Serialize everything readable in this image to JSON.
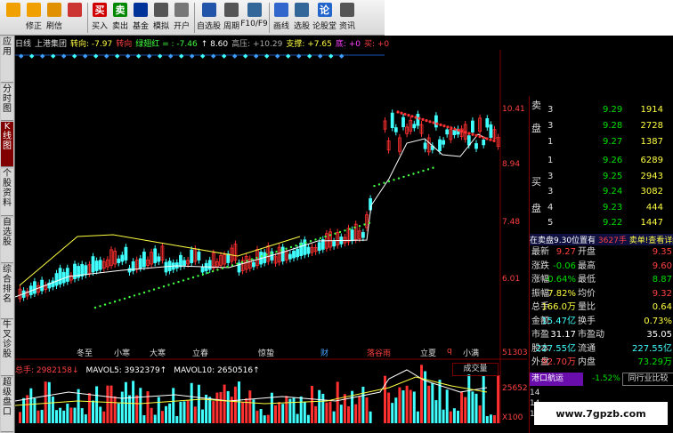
{
  "toolbar": [
    {
      "label": "",
      "icon": "back-arrow-icon",
      "color": "#f0a000"
    },
    {
      "label": "修正",
      "icon": "up-down-arrow-icon",
      "color": "#f0a000"
    },
    {
      "label": "刷信",
      "icon": "refresh-icon",
      "color": "#e09000"
    },
    {
      "label": "",
      "icon": "clock-icon",
      "color": "#cc3333"
    },
    {
      "label": "买入",
      "icon": "buy-icon",
      "color": "#d00000",
      "glyph": "买"
    },
    {
      "label": "卖出",
      "icon": "sell-icon",
      "color": "#008800",
      "glyph": "卖"
    },
    {
      "label": "基金",
      "icon": "fund-icon",
      "color": "#003399"
    },
    {
      "label": "模拟",
      "icon": "hammer-icon",
      "color": "#555555"
    },
    {
      "label": "开户",
      "icon": "lock-icon",
      "color": "#777777"
    },
    {
      "label": "自选股",
      "icon": "favorite-icon",
      "color": "#2255aa"
    },
    {
      "label": "周期",
      "icon": "cycle-icon",
      "color": "#555555"
    },
    {
      "label": "F10/F9",
      "icon": "f10-icon",
      "color": "#336699"
    },
    {
      "label": "画线",
      "icon": "pen-icon",
      "color": "#3366cc"
    },
    {
      "label": "选股",
      "icon": "filter-icon",
      "color": "#336699"
    },
    {
      "label": "论股堂",
      "icon": "forum-icon",
      "color": "#2266cc",
      "glyph": "论"
    },
    {
      "label": "资讯",
      "icon": "news-icon",
      "color": "#555555"
    }
  ],
  "sidetabs": [
    "应用",
    "分时图",
    "K线图",
    "个股资料",
    "自选股",
    "综合排名",
    "牛叉诊股",
    "超级盘口"
  ],
  "infobar": [
    {
      "text": "日线",
      "color": "#dddddd"
    },
    {
      "text": "上港集团",
      "color": "#dddddd"
    },
    {
      "text": "转向: -7.97",
      "color": "#ffff40"
    },
    {
      "text": "转向",
      "color": "#ff4040"
    },
    {
      "text": "绿翅红 = : -7.46",
      "color": "#40ff40"
    },
    {
      "text": "↑ 8.60",
      "color": "#ffffff"
    },
    {
      "text": "高压: +10.29",
      "color": "#aaaaaa"
    },
    {
      "text": "支撑: +7.65",
      "color": "#ffff40"
    },
    {
      "text": "底: +0",
      "color": "#ff40ff"
    },
    {
      "text": "买: +0",
      "color": "#ff4040"
    }
  ],
  "price_axis": [
    "10.41",
    "8.94",
    "7.48",
    "6.01"
  ],
  "volume_axis": [
    "51303",
    "25652",
    "X100"
  ],
  "date_axis": [
    {
      "t": "冬至",
      "c": "#dddddd"
    },
    {
      "t": "小寒",
      "c": "#dddddd"
    },
    {
      "t": "大寒",
      "c": "#dddddd"
    },
    {
      "t": "立春",
      "c": "#dddddd"
    },
    {
      "t": "惊蛰",
      "c": "#dddddd"
    },
    {
      "t": "财",
      "c": "#40a0ff"
    },
    {
      "t": "落谷雨",
      "c": "#ff4040"
    },
    {
      "t": "立夏",
      "c": "#dddddd"
    },
    {
      "t": "q",
      "c": "#ff4040"
    },
    {
      "t": "小满",
      "c": "#dddddd"
    }
  ],
  "volume_legend": [
    {
      "text": "总手: 2982158↓",
      "color": "#ff4040"
    },
    {
      "text": "MAVOL5: 3932379↑",
      "color": "#ffffff"
    },
    {
      "text": "MAVOL10: 2650516↑",
      "color": "#ffffff"
    }
  ],
  "volume_tab": "成交量",
  "sell_orders": [
    {
      "level": "3",
      "price": "9.29",
      "vol": "1914"
    },
    {
      "level": "3",
      "price": "9.28",
      "vol": "2728"
    },
    {
      "level": "1",
      "price": "9.27",
      "vol": "1387"
    }
  ],
  "buy_orders": [
    {
      "level": "1",
      "price": "9.26",
      "vol": "6289"
    },
    {
      "level": "3",
      "price": "9.25",
      "vol": "2943"
    },
    {
      "level": "3",
      "price": "9.24",
      "vol": "3082"
    },
    {
      "level": "4",
      "price": "9.23",
      "vol": "444"
    },
    {
      "level": "5",
      "price": "9.22",
      "vol": "1447"
    }
  ],
  "side_labels": {
    "sell1": "卖",
    "sell2": "盘",
    "buy1": "买",
    "buy2": "盘"
  },
  "order_banner": {
    "left": "在卖盘9.30位置有",
    "mid": "3627手",
    "right": "卖单!查看详细"
  },
  "stats": [
    {
      "l1": "最新",
      "v1": "9.27",
      "c1": "#ff4040",
      "l2": "开盘",
      "v2": "9.35",
      "c2": "#ff4040"
    },
    {
      "l1": "涨跌",
      "v1": "-0.06",
      "c1": "#00e000",
      "l2": "最高",
      "v2": "9.60",
      "c2": "#ff4040"
    },
    {
      "l1": "涨幅",
      "v1": "-0.64%",
      "c1": "#00e000",
      "l2": "最低",
      "v2": "8.87",
      "c2": "#00e000"
    },
    {
      "l1": "振幅",
      "v1": "7.82%",
      "c1": "#ffff40",
      "l2": "均价",
      "v2": "9.32",
      "c2": "#ff4040"
    },
    {
      "l1": "总手",
      "v1": "166.0万",
      "c1": "#ffff40",
      "l2": "量比",
      "v2": "0.64",
      "c2": "#ffff40"
    },
    {
      "l1": "金额",
      "v1": "15.47亿",
      "c1": "#40ffff",
      "l2": "换手",
      "v2": "0.73%",
      "c2": "#ffff40"
    },
    {
      "l1": "市盈",
      "v1": "31.17",
      "c1": "#ffffff",
      "l2": "市盈动",
      "v2": "35.05",
      "c2": "#ffffff"
    },
    {
      "l1": "股本",
      "v1": "227.55亿",
      "c1": "#40ffff",
      "l2": "流通",
      "v2": "227.55亿",
      "c2": "#40ffff"
    },
    {
      "l1": "外盘",
      "v1": "92.70万",
      "c1": "#ff4040",
      "l2": "内盘",
      "v2": "73.29万",
      "c2": "#00e000"
    }
  ],
  "bottom": {
    "sector": "港口航运",
    "pct": "-1.52%",
    "compare": "同行业比较"
  },
  "partial_lines": [
    "14",
    "14",
    "14"
  ],
  "watermark": "www.7gpzb.com"
}
